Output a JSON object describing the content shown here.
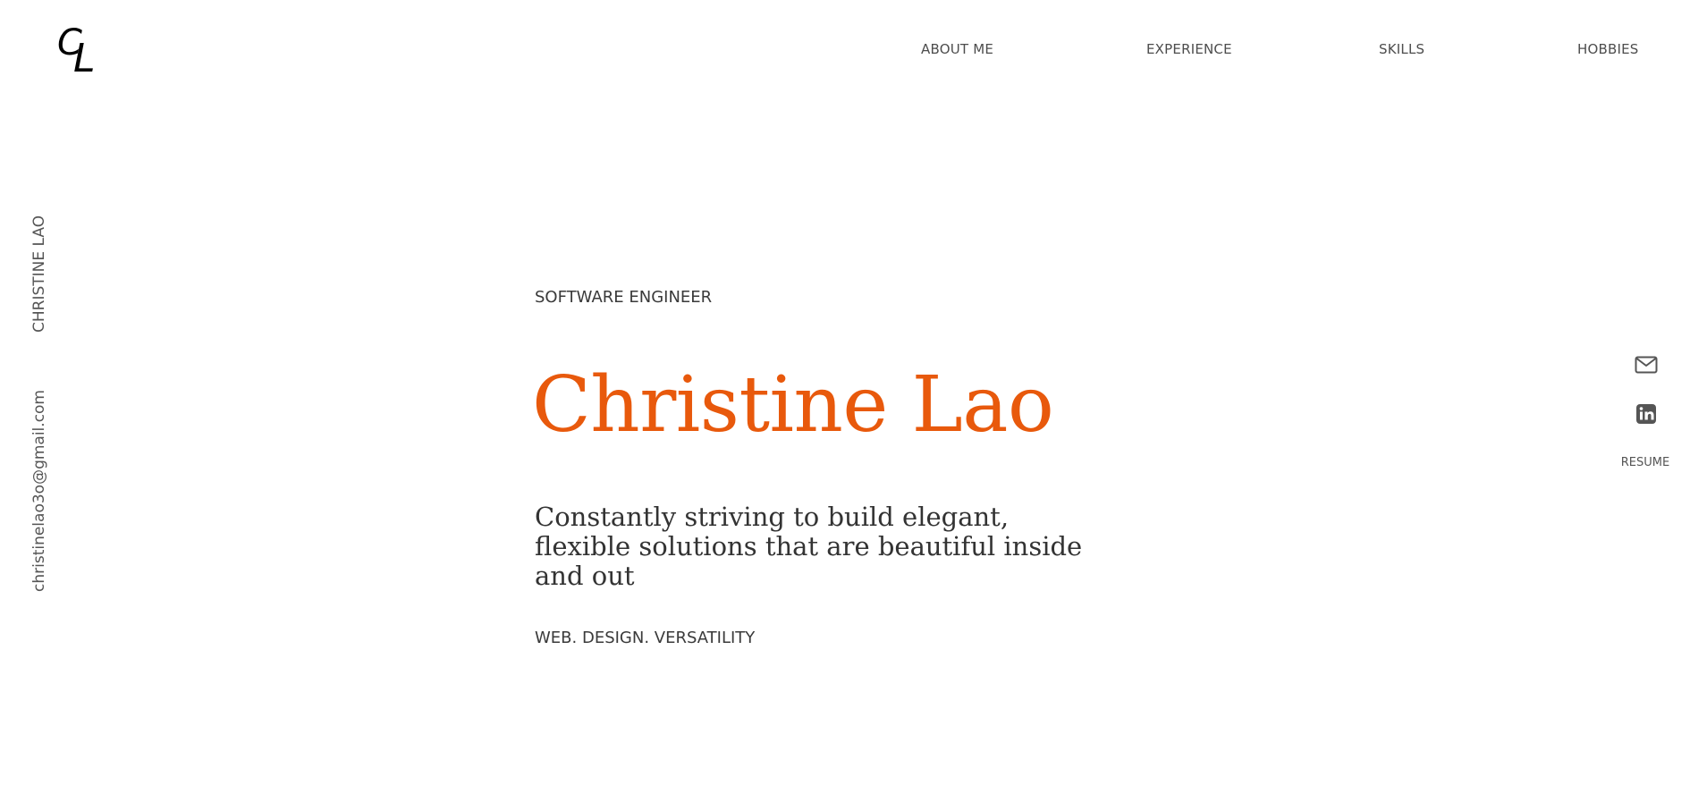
{
  "logo": {
    "letter_c": "C",
    "letter_l": "L"
  },
  "nav": {
    "items": [
      {
        "label": "ABOUT ME"
      },
      {
        "label": "EXPERIENCE"
      },
      {
        "label": "SKILLS"
      },
      {
        "label": "HOBBIES"
      }
    ]
  },
  "sidebar_left": {
    "name": "CHRISTINE LAO",
    "email": "christinelao3o@gmail.com"
  },
  "hero": {
    "role": "SOFTWARE ENGINEER",
    "name": "Christine Lao",
    "tagline": "Constantly striving to build elegant, flexible solutions that are beautiful inside and out",
    "keywords": "WEB. DESIGN. VERSATILITY"
  },
  "social": {
    "email_icon": "envelope-icon",
    "linkedin_icon": "linkedin-icon",
    "resume_label": "RESUME"
  },
  "colors": {
    "accent": "#e8590c",
    "text": "#333333",
    "nav_text": "#4d4d4d",
    "icon": "#555555",
    "background": "#ffffff"
  }
}
